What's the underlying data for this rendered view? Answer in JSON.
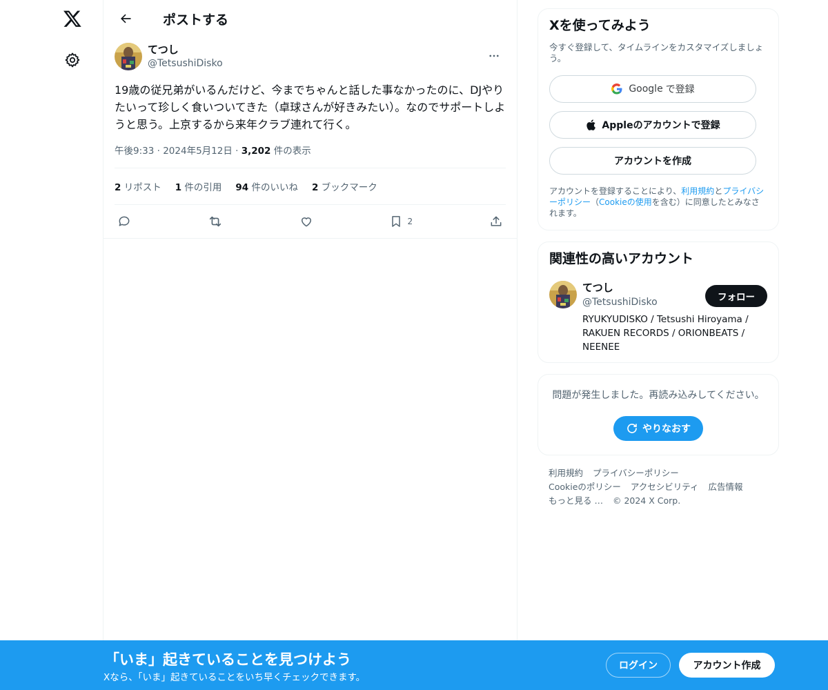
{
  "nav": {
    "logo_icon": "x-logo-icon",
    "settings_icon": "gear-icon"
  },
  "header": {
    "title": "ポストする"
  },
  "post": {
    "author_name": "てつし",
    "author_handle": "@TetsushiDisko",
    "text": "19歳の従兄弟がいるんだけど、今までちゃんと話した事なかったのに、DJやりたいって珍しく食いついてきた（卓球さんが好きみたい）。なのでサポートしようと思う。上京するから来年クラブ連れて行く。",
    "time": "午後9:33",
    "date": "2024年5月12日",
    "views_count": "3,202",
    "views_label": "件の表示",
    "sep": "·",
    "stats": [
      {
        "count": "2",
        "label": "リポスト"
      },
      {
        "count": "1",
        "label": "件の引用"
      },
      {
        "count": "94",
        "label": "件のいいね"
      },
      {
        "count": "2",
        "label": "ブックマーク"
      }
    ],
    "bookmark_count": "2"
  },
  "signup_card": {
    "title": "Xを使ってみよう",
    "subtitle": "今すぐ登録して、タイムラインをカスタマイズしましょう。",
    "google_brand": "Google",
    "google_suffix": "で登録",
    "apple_label": "Appleのアカウントで登録",
    "create_label": "アカウントを作成",
    "legal_prefix": "アカウントを登録することにより、",
    "legal_terms": "利用規約",
    "legal_and": "と",
    "legal_privacy": "プライバシーポリシー",
    "legal_paren_open": "（",
    "legal_cookie": "Cookieの使用",
    "legal_suffix": "を含む）に同意したとみなされます。"
  },
  "related_card": {
    "title": "関連性の高いアカウント",
    "name": "てつし",
    "handle": "@TetsushiDisko",
    "bio": "RYUKYUDISKO / Tetsushi Hiroyama / RAKUEN RECORDS / ORIONBEATS / NEENEE",
    "follow_label": "フォロー"
  },
  "error_card": {
    "message": "問題が発生しました。再読み込みしてください。",
    "retry_label": "やりなおす"
  },
  "footer": {
    "links_row1": [
      "利用規約",
      "プライバシーポリシー"
    ],
    "links_row2": [
      "Cookieのポリシー",
      "アクセシビリティ",
      "広告情報"
    ],
    "more": "もっと見る …",
    "copyright": "© 2024 X Corp."
  },
  "banner": {
    "title": "「いま」起きていることを見つけよう",
    "subtitle": "Xなら、「いま」起きていることをいち早くチェックできます。",
    "login_label": "ログイン",
    "signup_label": "アカウント作成"
  },
  "colors": {
    "accent": "#1d9bf0",
    "text": "#0f1419",
    "secondary": "#536471",
    "border": "#eff3f4"
  }
}
